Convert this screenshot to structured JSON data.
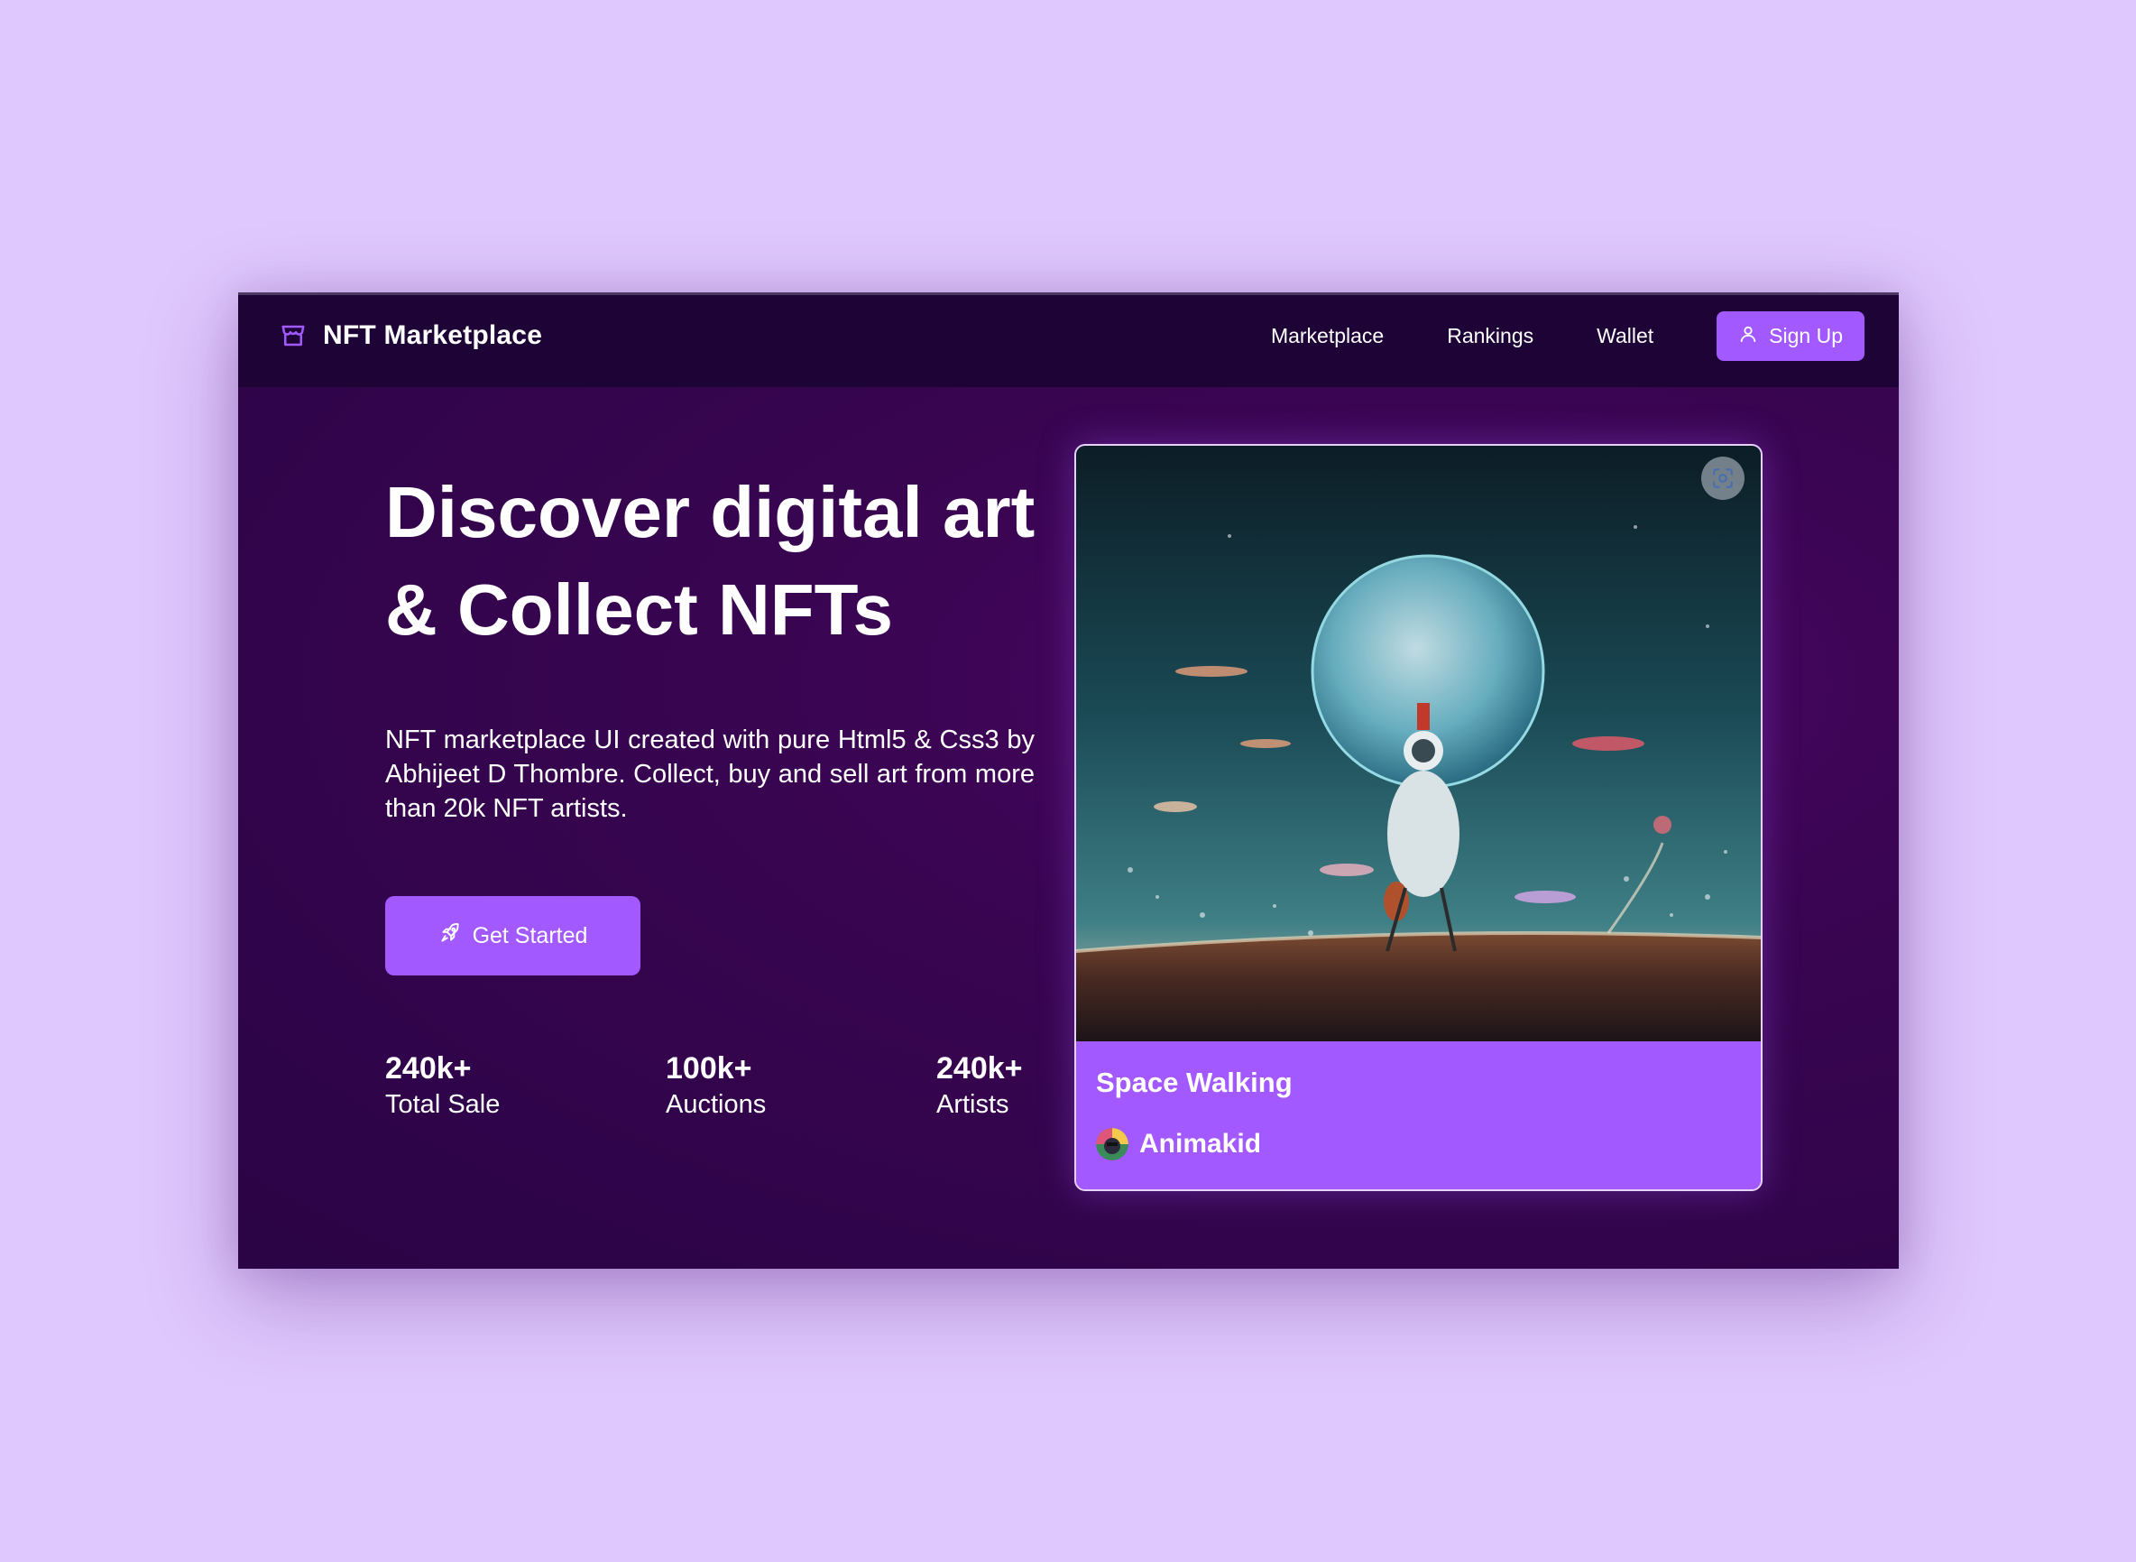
{
  "header": {
    "brand": "NFT Marketplace",
    "nav": [
      {
        "label": "Marketplace"
      },
      {
        "label": "Rankings"
      },
      {
        "label": "Wallet"
      }
    ],
    "signup_label": "Sign Up"
  },
  "hero": {
    "title": "Discover digital art & Collect NFTs",
    "description": "NFT marketplace UI created with pure Html5 & Css3 by Abhijeet D Thombre. Collect, buy and sell art from more than 20k NFT artists.",
    "cta_label": "Get Started"
  },
  "stats": [
    {
      "value": "240k+",
      "label": "Total Sale"
    },
    {
      "value": "100k+",
      "label": "Auctions"
    },
    {
      "value": "240k+",
      "label": "Artists"
    }
  ],
  "card": {
    "title": "Space Walking",
    "artist": "Animakid"
  },
  "icons": {
    "brand": "storefront-icon",
    "signup": "user-icon",
    "cta": "rocket-icon",
    "lens": "scan-icon"
  },
  "colors": {
    "page_background": "#dfc8fd",
    "topbar": "#1e0336",
    "hero_background": "#3a0552",
    "accent": "#a259ff",
    "text": "#ffffff"
  }
}
